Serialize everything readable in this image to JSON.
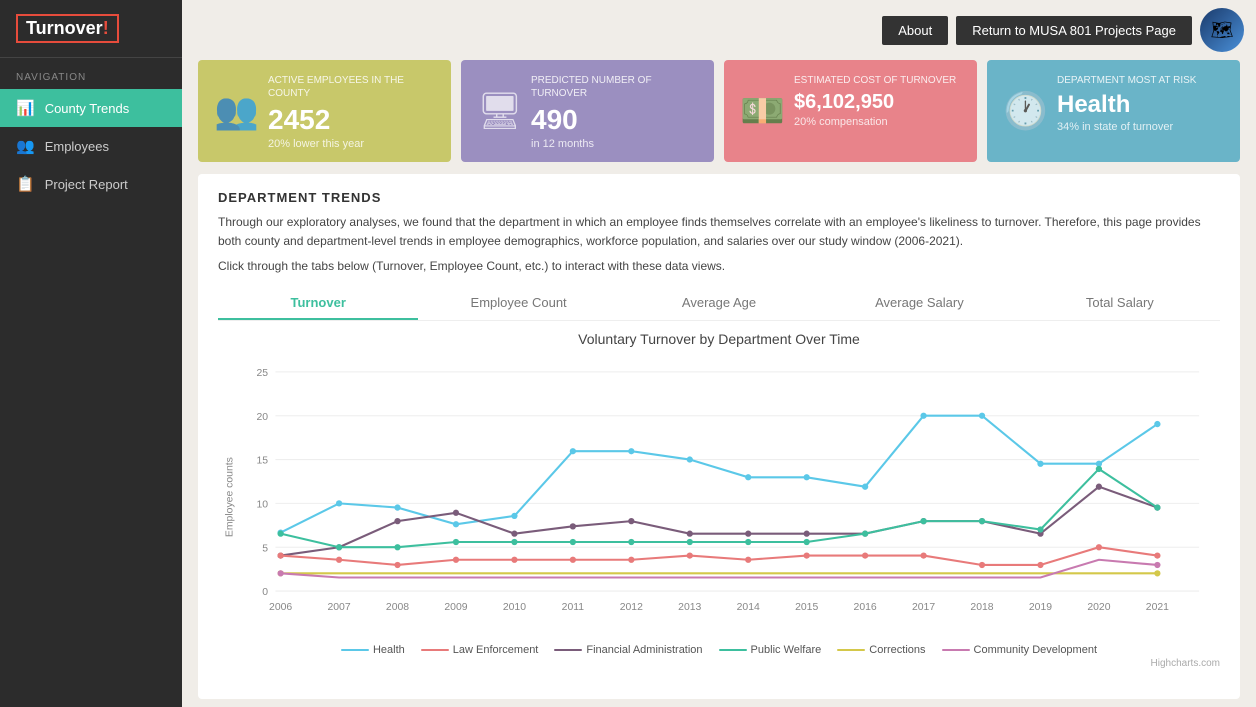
{
  "logo": {
    "text": "Turnover",
    "highlight": "!"
  },
  "nav": {
    "label": "NAVIGATION",
    "items": [
      {
        "id": "county-trends",
        "label": "County Trends",
        "icon": "📊",
        "active": true
      },
      {
        "id": "employees",
        "label": "Employees",
        "icon": "👥",
        "active": false
      },
      {
        "id": "project-report",
        "label": "Project Report",
        "icon": "📋",
        "active": false
      }
    ]
  },
  "topbar": {
    "about_label": "About",
    "return_label": "Return to MUSA 801 Projects Page",
    "logo_icon": "🗺"
  },
  "cards": [
    {
      "id": "active-employees",
      "label": "ACTIVE EMPLOYEES IN THE COUNTY",
      "value": "2452",
      "sub": "20% lower this year",
      "icon": "👥",
      "color": "#c8c86a"
    },
    {
      "id": "predicted-turnover",
      "label": "PREDICTED NUMBER OF TURNOVER",
      "value": "490",
      "sub": "in 12 months",
      "icon": "🖥",
      "color": "#9b8fc0"
    },
    {
      "id": "estimated-cost",
      "label": "ESTIMATED COST OF TURNOVER",
      "value": "$6,102,950",
      "sub": "20% compensation",
      "icon": "💵",
      "color": "#e8838a"
    },
    {
      "id": "dept-most-at-risk",
      "label": "DEPARTMENT MOST AT RISK",
      "value": "Health",
      "sub": "34% in state of turnover",
      "icon": "🕐",
      "color": "#6ab4c8"
    }
  ],
  "department_trends": {
    "title": "DEPARTMENT TRENDS",
    "description": "Through our exploratory analyses, we found that the department in which an employee finds themselves correlate with an employee's likeliness to turnover. Therefore, this page provides both county and department-level trends in employee demographics, workforce population, and salaries over our study window (2006-2021).",
    "click_note": "Click through the tabs below (Turnover, Employee Count, etc.) to interact with these data views.",
    "tabs": [
      {
        "id": "turnover",
        "label": "Turnover",
        "active": true
      },
      {
        "id": "employee-count",
        "label": "Employee Count",
        "active": false
      },
      {
        "id": "average-age",
        "label": "Average Age",
        "active": false
      },
      {
        "id": "average-salary",
        "label": "Average Salary",
        "active": false
      },
      {
        "id": "total-salary",
        "label": "Total Salary",
        "active": false
      }
    ],
    "chart_title": "Voluntary Turnover by Department Over Time",
    "y_label": "Employee counts",
    "x_years": [
      "2006",
      "2007",
      "2008",
      "2009",
      "2010",
      "2011",
      "2012",
      "2013",
      "2014",
      "2015",
      "2016",
      "2017",
      "2018",
      "2019",
      "2020",
      "2021"
    ],
    "legend": [
      {
        "label": "Health",
        "color": "#5bc8e8"
      },
      {
        "label": "Law Enforcement",
        "color": "#e87a7a"
      },
      {
        "label": "Financial Administration",
        "color": "#7a5c7a"
      },
      {
        "label": "Public Welfare",
        "color": "#3dbf9e"
      },
      {
        "label": "Corrections",
        "color": "#d4c84a"
      },
      {
        "label": "Community Development",
        "color": "#c87ab0"
      }
    ],
    "highcharts_credit": "Highcharts.com"
  }
}
